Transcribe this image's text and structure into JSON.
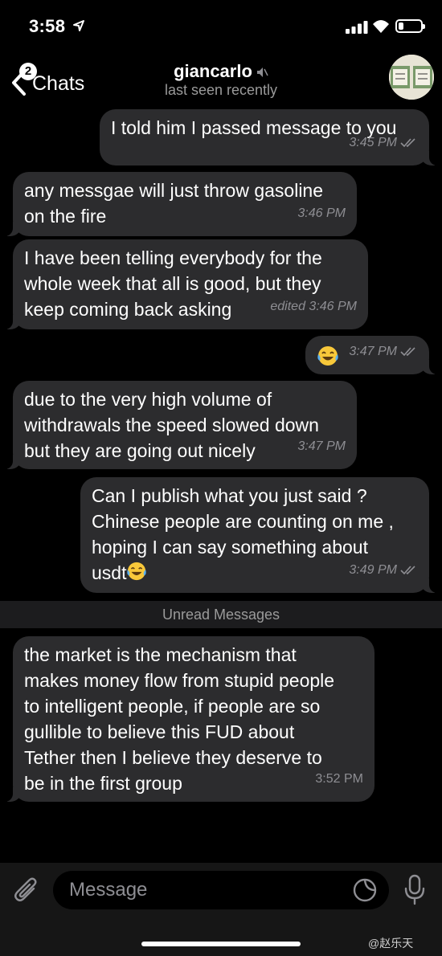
{
  "status_bar": {
    "time": "3:58"
  },
  "nav": {
    "unread_count": "2",
    "back_label": "Chats",
    "contact_name": "giancarlo",
    "contact_status": "last seen recently"
  },
  "messages": [
    {
      "direction": "out",
      "text": "I told him I passed message to you",
      "time": "3:45 PM"
    },
    {
      "direction": "in",
      "text": "any messgae will just throw gasoline\non the fire",
      "time": "3:46 PM"
    },
    {
      "direction": "in",
      "text": "I have been telling everybody for the\nwhole week that all is good, but they\nkeep coming back asking",
      "time": "edited 3:46 PM"
    },
    {
      "direction": "out",
      "text": "😂",
      "time": "3:47 PM"
    },
    {
      "direction": "in",
      "text": "due to the very high volume of\nwithdrawals the speed slowed down\nbut they are going out nicely",
      "time": "3:47 PM"
    },
    {
      "direction": "out",
      "text": "Can I publish what you just said ?\nChinese people are counting on me ,\nhoping I can say something about\nusdt",
      "time": "3:49 PM"
    },
    {
      "direction": "in",
      "text": "the market is the mechanism that\nmakes money flow from stupid people\nto intelligent people, if people are so\ngullible to believe this FUD about\nTether then I believe they deserve to\nbe in the first group",
      "time": "3:52 PM"
    }
  ],
  "unread_divider": "Unread Messages",
  "input": {
    "placeholder": "Message"
  },
  "watermark": "@赵乐天",
  "colors": {
    "background": "#000000",
    "bubble": "#2c2c2e",
    "meta": "#8e8e93",
    "input_bar": "#161616"
  }
}
